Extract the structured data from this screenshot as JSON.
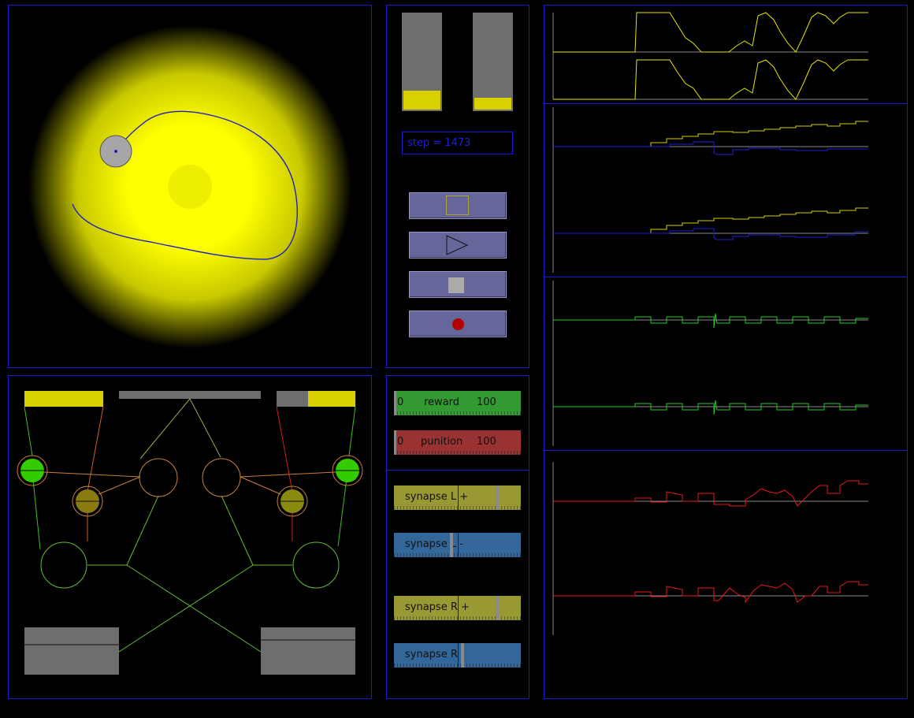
{
  "colors": {
    "panel_border": "#1a1ad0",
    "yellow": "#d8d000",
    "gray": "#6e6e6e",
    "green_neuron": "#33cc00",
    "olive_neuron": "#8b7a10",
    "reward_green": "#339933",
    "punition_red": "#993333",
    "synapse_plus": "#999933",
    "synapse_minus": "#336699",
    "trace_yellow": "#e6e600",
    "trace_blue": "#2020d8",
    "trace_green": "#22cc22",
    "trace_red": "#e61a1a"
  },
  "status": {
    "step_label": "step = 1473"
  },
  "meters": {
    "left_level": 0.2,
    "right_level": 0.12
  },
  "buttons": [
    {
      "icon": "step-frame-icon"
    },
    {
      "icon": "play-icon"
    },
    {
      "icon": "stop-icon"
    },
    {
      "icon": "record-icon"
    }
  ],
  "reward": {
    "label": "reward",
    "min": "0",
    "max": "100",
    "value": 0
  },
  "punition": {
    "label": "punition",
    "min": "0",
    "max": "100",
    "value": 0
  },
  "synapses": [
    {
      "label": "synapse L +",
      "value": 0.82,
      "marker": 0.5
    },
    {
      "label": "synapse L -",
      "value": 0.45,
      "marker": 0.5
    },
    {
      "label": "synapse R +",
      "value": 0.82,
      "marker": 0.5
    },
    {
      "label": "synapse R -",
      "value": 0.54,
      "marker": 0.5
    }
  ],
  "network": {
    "left_sensor_fill": 1.0,
    "right_sensor_fill": 0.6,
    "left_motor_level": 0.1,
    "right_motor_level": 0.2
  }
}
